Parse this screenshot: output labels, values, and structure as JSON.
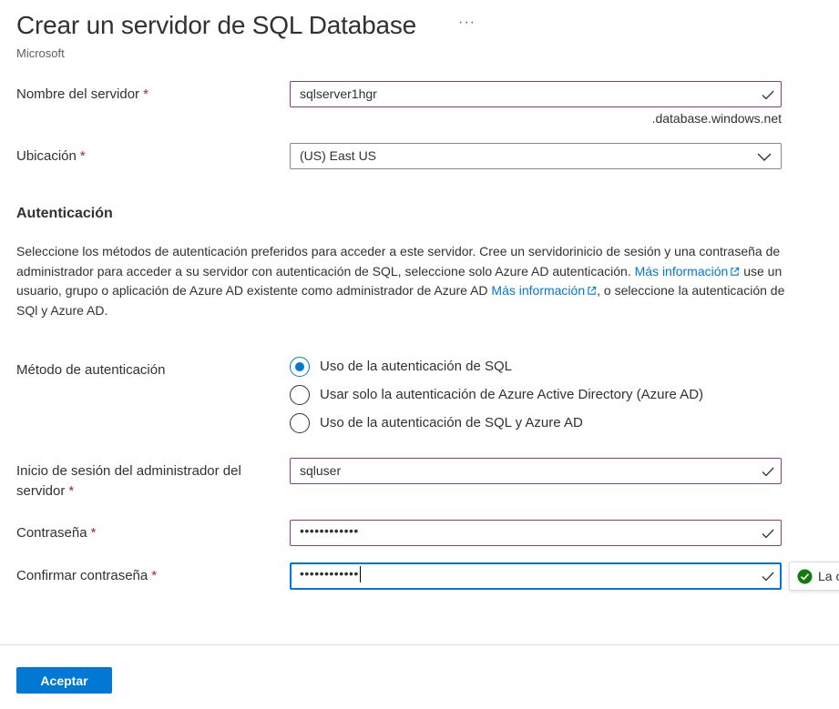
{
  "header": {
    "title": "Crear un servidor de SQL Database",
    "more_label": "···",
    "publisher": "Microsoft"
  },
  "form": {
    "server_name": {
      "label": "Nombre del servidor",
      "required_mark": "*",
      "value": "sqlserver1hgr",
      "suffix": ".database.windows.net"
    },
    "location": {
      "label": "Ubicación",
      "required_mark": "*",
      "value": "(US) East US"
    },
    "authentication": {
      "heading": "Autenticación",
      "description_part1": "Seleccione los métodos de autenticación preferidos para acceder a este servidor. Cree un servidorinicio de sesión y una contraseña de administrador para acceder a su servidor con autenticación de SQL, seleccione solo Azure AD autenticación.",
      "link1": "Más información",
      "description_part2": "use un usuario, grupo o aplicación de Azure AD existente como administrador de Azure AD",
      "link2": "Más información",
      "description_part3": ", o seleccione la autenticación de SQl y Azure AD.",
      "method_label": "Método de autenticación",
      "options": [
        {
          "label": "Uso de la autenticación de SQL",
          "selected": true
        },
        {
          "label": "Usar solo la autenticación de Azure Active Directory (Azure AD)",
          "selected": false
        },
        {
          "label": "Uso de la autenticación de SQL y Azure AD",
          "selected": false
        }
      ]
    },
    "admin_login": {
      "label": "Inicio de sesión del administrador del servidor",
      "required_mark": "*",
      "value": "sqluser"
    },
    "password": {
      "label": "Contraseña",
      "required_mark": "*",
      "masked_value": "••••••••••••"
    },
    "confirm_password": {
      "label": "Confirmar contraseña",
      "required_mark": "*",
      "masked_value": "••••••••••••"
    },
    "validation_tooltip": {
      "text": "La c",
      "icon": "success-check-icon"
    }
  },
  "footer": {
    "accept_label": "Aceptar"
  },
  "colors": {
    "accent": "#0078d4",
    "valid_border": "#8a3b89",
    "required": "#a4262c",
    "success": "#107c10"
  }
}
